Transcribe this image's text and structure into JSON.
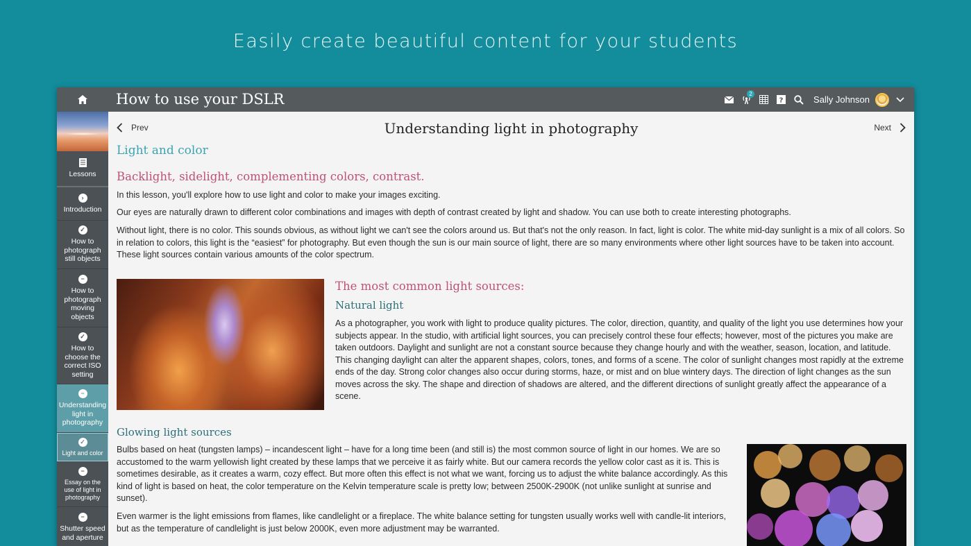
{
  "tagline": "Easily create beautiful content for your students",
  "header": {
    "course_title": "How to use your DSLR",
    "notification_count": "2",
    "user_name": "Sally Johnson",
    "icons": [
      "home-icon",
      "mail-icon",
      "broadcast-icon",
      "calendar-icon",
      "help-icon",
      "search-icon",
      "chevron-down-icon"
    ]
  },
  "sidebar": {
    "items": [
      {
        "label": "Lessons",
        "icon": "lessons-icon"
      },
      {
        "label": "Introduction",
        "icon": "chevron-right-icon"
      },
      {
        "label": "How to photograph still objects",
        "icon": "check-icon"
      },
      {
        "label": "How to photograph moving objects",
        "icon": "minus-icon"
      },
      {
        "label": "How to choose the correct ISO setting",
        "icon": "check-icon"
      },
      {
        "label": "Understanding light in photography",
        "icon": "minus-icon"
      },
      {
        "label": "Light and color",
        "icon": "check-icon"
      },
      {
        "label": "Essay on the use of light in photography",
        "icon": "minus-icon"
      },
      {
        "label": "Shutter speed and aperture",
        "icon": "minus-icon"
      }
    ]
  },
  "page": {
    "prev_label": "Prev",
    "next_label": "Next",
    "title": "Understanding light in photography",
    "section_title": "Light and color",
    "subtitle": "Backlight, sidelight, complementing colors, contrast.",
    "intro_p1": "In this lesson, you'll explore how to use light and color to make your images exciting.",
    "intro_p2": "Our eyes are naturally drawn to different color combinations and images with depth of contrast created by light and shadow. You can use both to create interesting photographs.",
    "intro_p3": "Without light, there is no color. This sounds obvious, as without light we can't see the colors around us. But that's not the only reason. In fact, light is color. The white mid-day sunlight is a mix of all colors. So in relation to colors, this light is the “easiest” for photography. But even though the sun is our main source of light, there are so many environments where other light sources have to be taken into account. These light sources contain various amounts of the color spectrum.",
    "sources_title": "The most common light sources:",
    "natural_title": "Natural light",
    "natural_p": "As a photographer, you work with light to produce quality pictures. The color, direction, quantity, and quality of the light you use determines how your subjects appear. In the studio, with artificial light sources, you can precisely control these four effects; however, most of the pictures you make are taken outdoors. Daylight and sunlight are not a constant source because they change hourly and with the weather, season, location, and latitude. This changing daylight can alter the apparent shapes, colors, tones, and forms of a scene. The color of sunlight changes most rapidly at the extreme ends of the day. Strong color changes also occur during storms, haze, or mist and on blue wintery days. The direction of light changes as the sun moves across the sky. The shape and direction of shadows are altered, and the different directions of sunlight greatly affect the appearance of a scene.",
    "glowing_title": "Glowing light sources",
    "glowing_p1": "Bulbs based on heat (tungsten lamps) – incandescent light – have for a long time been (and still is) the most common source of light in our homes. We are so accustomed to the warm yellowish light created by these lamps that we perceive it as fairly white. But our camera records the yellow color cast as it is. This is sometimes desirable, as it creates a warm, cozy effect. But more often this effect is not what we want, forcing us to adjust the white balance accordingly. As this kind of light is based on heat, the color temperature on the Kelvin temperature scale is pretty low; between 2500K-2900K (not unlike sunlight at sunrise and sunset).",
    "glowing_p2": "Even warmer is the light emissions from flames, like candlelight or a fireplace. The white balance setting for tungsten usually works well with candle-lit interiors, but as the temperature of candlelight is just below 2000K, even more adjustment may be warranted."
  },
  "colors": {
    "background": "#138c9c",
    "topbar": "#555a5d",
    "sidebar": "#4c5155",
    "active_item": "#5e9ea8",
    "heading_teal": "#3ba3b1",
    "heading_pink": "#c0507a"
  }
}
